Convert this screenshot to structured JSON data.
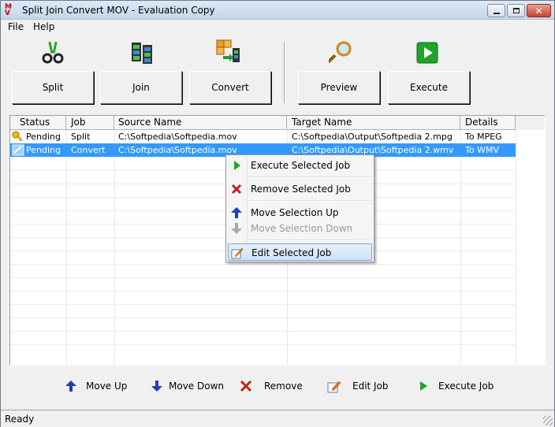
{
  "window": {
    "title": "Split Join Convert MOV - Evaluation Copy",
    "app_icon": "M V"
  },
  "menu": [
    {
      "label": "File"
    },
    {
      "label": "Help"
    }
  ],
  "toolbar": {
    "split_label": "Split",
    "join_label": "Join",
    "convert_label": "Convert",
    "preview_label": "Preview",
    "execute_label": "Execute"
  },
  "list": {
    "columns": [
      "Status",
      "Job",
      "Source Name",
      "Target Name",
      "Details"
    ],
    "rows": [
      {
        "status": "Pending",
        "job": "Split",
        "source": "C:\\Softpedia\\Softpedia.mov",
        "target": "C:\\Softpedia\\Output\\Softpedia 2.mpg",
        "details": "To MPEG"
      },
      {
        "status": "Pending",
        "job": "Convert",
        "source": "C:\\Softpedia\\Softpedia.mov",
        "target": "C:\\Softpedia\\Output\\Softpedia 2.wmv",
        "details": "To WMV"
      }
    ]
  },
  "context_menu": {
    "execute": "Execute Selected Job",
    "remove": "Remove Selected Job",
    "move_up": "Move Selection Up",
    "move_down": "Move Selection Down",
    "edit": "Edit Selected Job"
  },
  "bottom_bar": {
    "move_up": "Move Up",
    "move_down": "Move Down",
    "remove": "Remove",
    "edit_job": "Edit Job",
    "execute_job": "Execute Job"
  },
  "status_bar": {
    "text": "Ready"
  },
  "colors": {
    "selection": "#3399ff",
    "play_green": "#1fa32a",
    "arrow_blue": "#1a3fbf",
    "remove_red": "#c0201a"
  }
}
